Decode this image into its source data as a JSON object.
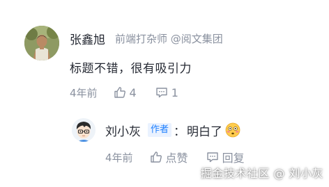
{
  "comment": {
    "author_name": "张鑫旭",
    "author_meta": "前端打杂师 @阅文集团",
    "text": "标题不错，很有吸引力",
    "time": "4年前",
    "like_count": "4",
    "reply_count": "1",
    "avatar_icon": "user-photo-avatar"
  },
  "reply": {
    "author_name": "刘小灰",
    "badge": "作者",
    "separator": "：",
    "text": "明白了",
    "emoji": "flushed-face-emoji",
    "time": "4年前",
    "like_label": "点赞",
    "reply_label": "回复",
    "avatar_icon": "cartoon-boy-avatar"
  },
  "watermark": "掘金技术社区 @ 刘小灰",
  "colors": {
    "text_primary": "#252933",
    "text_secondary": "#8a919f",
    "badge_blue": "#1e80ff",
    "badge_bg": "#eaf2ff"
  }
}
